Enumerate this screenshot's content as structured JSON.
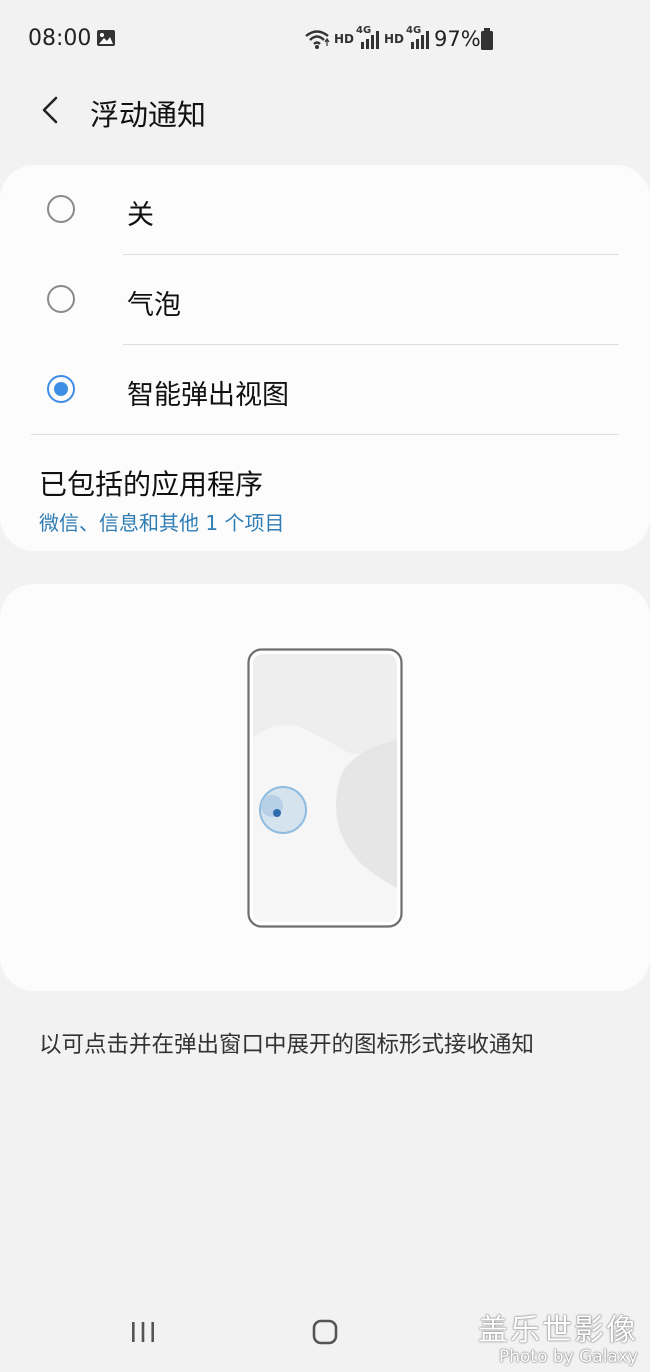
{
  "status_bar": {
    "time": "08:00",
    "network_1": "HD",
    "network_1_gen": "4G",
    "network_2": "HD",
    "network_2_gen": "4G",
    "battery": "97%",
    "icons": [
      "image-icon",
      "wifi-icon",
      "signal-icon",
      "signal-icon",
      "battery-icon"
    ]
  },
  "header": {
    "title": "浮动通知",
    "back_icon": "chevron-left-icon"
  },
  "options": [
    {
      "label": "关",
      "selected": false
    },
    {
      "label": "气泡",
      "selected": false
    },
    {
      "label": "智能弹出视图",
      "selected": true
    }
  ],
  "included_apps": {
    "title": "已包括的应用程序",
    "subtitle": "微信、信息和其他 1 个项目"
  },
  "description": "以可点击并在弹出窗口中展开的图标形式接收通知",
  "navigation": {
    "recent_icon": "recent-apps-icon",
    "home_icon": "home-icon"
  },
  "watermark": {
    "line1": "盖乐世影像",
    "line2": "Photo by Galaxy"
  },
  "colors": {
    "accent": "#3e8ee6",
    "link": "#2f7db5",
    "background": "#f2f2f2",
    "card": "#fcfcfc"
  }
}
